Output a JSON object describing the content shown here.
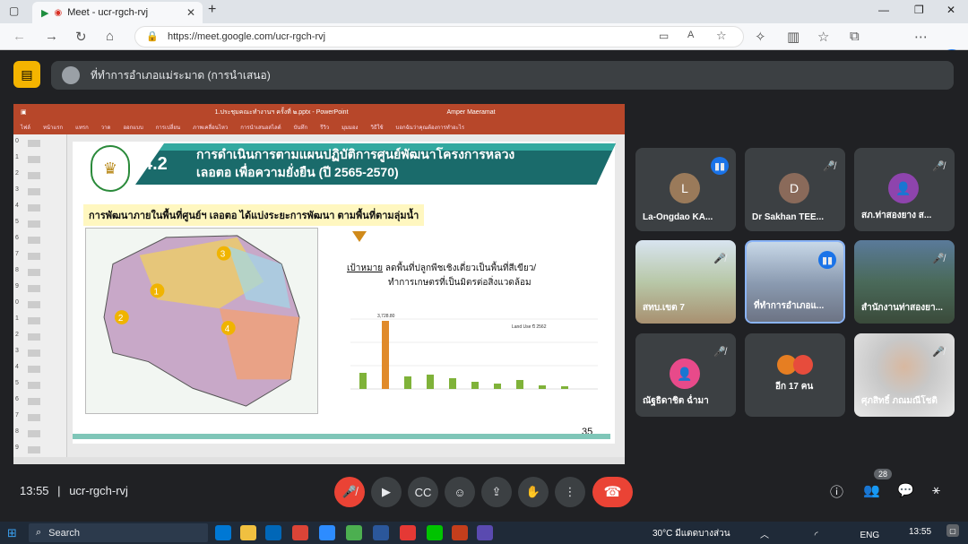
{
  "browser": {
    "tab_title": "Meet - ucr-rgch-rvj",
    "url": "https://meet.google.com/ucr-rgch-rvj",
    "new_tab_symbol": "+",
    "close_tab_symbol": "✕"
  },
  "presenter": {
    "label": "ที่ทำการอำเภอแม่ระมาด (การนำเสนอ)"
  },
  "powerpoint": {
    "title": "1.ประชุมคณะทำงานฯ ครั้งที่ ๒.pptx - PowerPoint",
    "user": "Amper Maeramat",
    "ribbon": [
      "ไฟล์",
      "หน้าแรก",
      "แทรก",
      "วาด",
      "ออกแบบ",
      "การเปลี่ยน",
      "ภาพเคลื่อนไหว",
      "การนำเสนอสไลด์",
      "บันทึก",
      "รีวิว",
      "มุมมอง",
      "วิธีใช้"
    ],
    "tell_me": "บอกฉันว่าคุณต้องการทำอะไร",
    "thumb_numbers": [
      "0",
      "1",
      "2",
      "3",
      "4",
      "5",
      "6",
      "7",
      "8",
      "9",
      "0",
      "1",
      "2",
      "3",
      "4",
      "5",
      "6",
      "7",
      "8",
      "9"
    ],
    "slide": {
      "number": "4.2",
      "heading_line1": "การดำเนินการตามแผนปฏิบัติการศูนย์พัฒนาโครงการหลวง",
      "heading_line2": "เลอตอ เพื่อความยั่งยืน (ปี 2565-2570)",
      "subheading": "การพัฒนาภายในพื้นที่ศูนย์ฯ เลอตอ ได้แบ่งระยะการพัฒนา ตามพื้นที่ตามลุ่มน้ำ",
      "goal_label": "เป้าหมาย",
      "goal_text1": "ลดพื้นที่ปลูกพืชเชิงเดี่ยวเป็นพื้นที่สีเขียว/",
      "goal_text2": "ทำการเกษตรที่เป็นมิตรต่อสิ่งแวดล้อม",
      "page_number": "35",
      "map_zones": [
        "1",
        "2",
        "3",
        "4"
      ],
      "chart_legend": "Land Use ปี 2562",
      "chart_peak_label": "3,728.80"
    }
  },
  "participants": [
    {
      "name": "La-Ongdao KA...",
      "initial": "L",
      "color": "#9a7a5a",
      "mic": "on"
    },
    {
      "name": "Dr Sakhan TEE...",
      "initial": "D",
      "color": "#8a6a5a",
      "mic": "off"
    },
    {
      "name": "สภ.ท่าสองยาง ส...",
      "initial": "",
      "color": "#8e44ad",
      "mic": "off"
    },
    {
      "name": "สทบ.เขต 7",
      "initial": "",
      "color": "#c8b08a",
      "mic": "off"
    },
    {
      "name": "ที่ทำการอำเภอแ...",
      "initial": "",
      "color": "#a0b0c8",
      "mic": "on"
    },
    {
      "name": "สำนักงานท่าสองยา...",
      "initial": "",
      "color": "#6a8a6a",
      "mic": "off"
    },
    {
      "name": "ณัฐธิดาชิต ฉ่ำมา",
      "initial": "",
      "color": "#e84a8a",
      "mic": "off"
    },
    {
      "name": "อีก 17 คน",
      "initial": "",
      "color": "#e67e22",
      "mic": ""
    },
    {
      "name": "ศุภสิทธิ์ ภณมณีโชติ",
      "initial": "",
      "color": "#d8d8d8",
      "mic": "off"
    }
  ],
  "meeting": {
    "time": "13:55",
    "separator": "|",
    "code": "ucr-rgch-rvj",
    "people_count": "28"
  },
  "taskbar": {
    "search_label": "Search",
    "weather": "30°C  มีแดดบางส่วน",
    "language": "ENG",
    "clock": "13:55"
  }
}
